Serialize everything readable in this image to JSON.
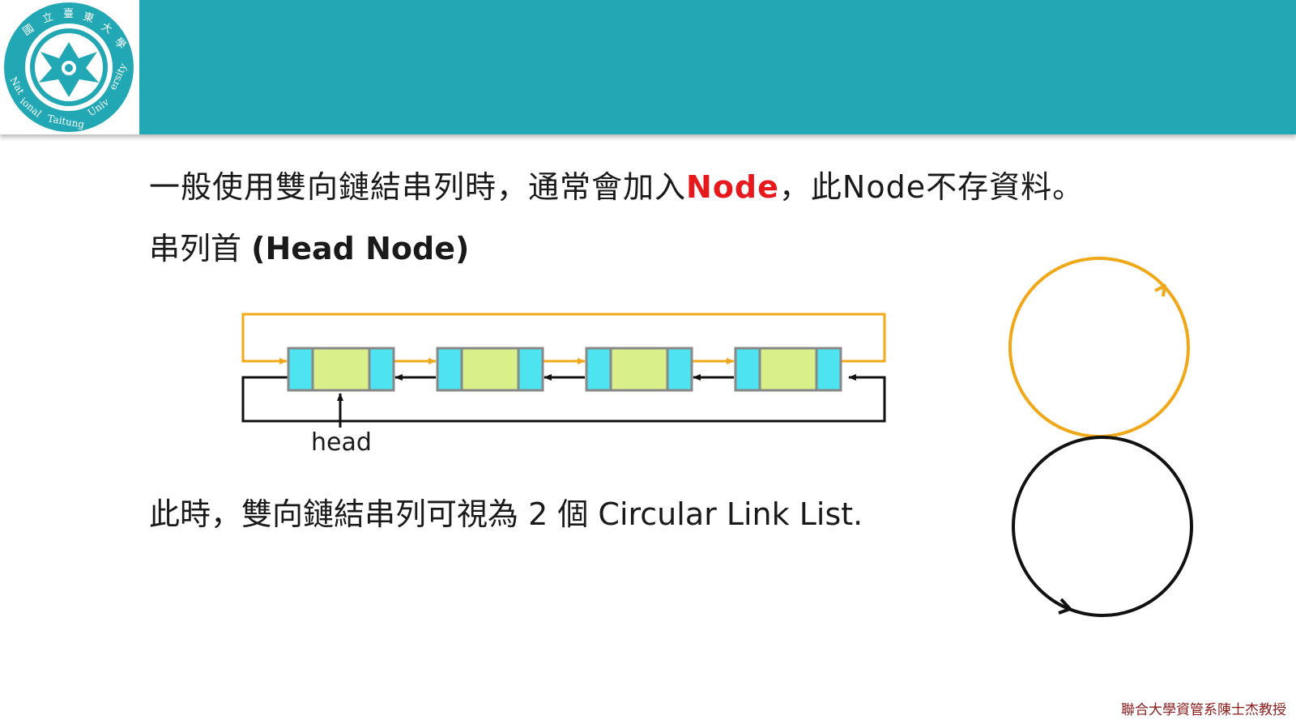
{
  "header": {
    "logo": {
      "ring_text_top": "國立臺東大學",
      "ring_text_bottom": "National Taitung University"
    }
  },
  "content": {
    "line1_prefix": "一般使用雙向鏈結串列時，通常會加入",
    "line1_highlight": "Node",
    "line1_suffix": "，此Node不存資料。",
    "line2_prefix": "串列首 ",
    "line2_bold": "(Head Node)",
    "line3": "此時，雙向鏈結串列可視為 2 個 Circular Link List."
  },
  "diagram": {
    "head_label": "head",
    "node_count": 4,
    "colors": {
      "forward_link": "#f0a818",
      "backward_link": "#111111",
      "node_pointer": "#4de3f0",
      "node_data": "#d9f08a",
      "node_border": "#888888"
    }
  },
  "footer": {
    "credit": "聯合大學資管系陳士杰教授"
  }
}
